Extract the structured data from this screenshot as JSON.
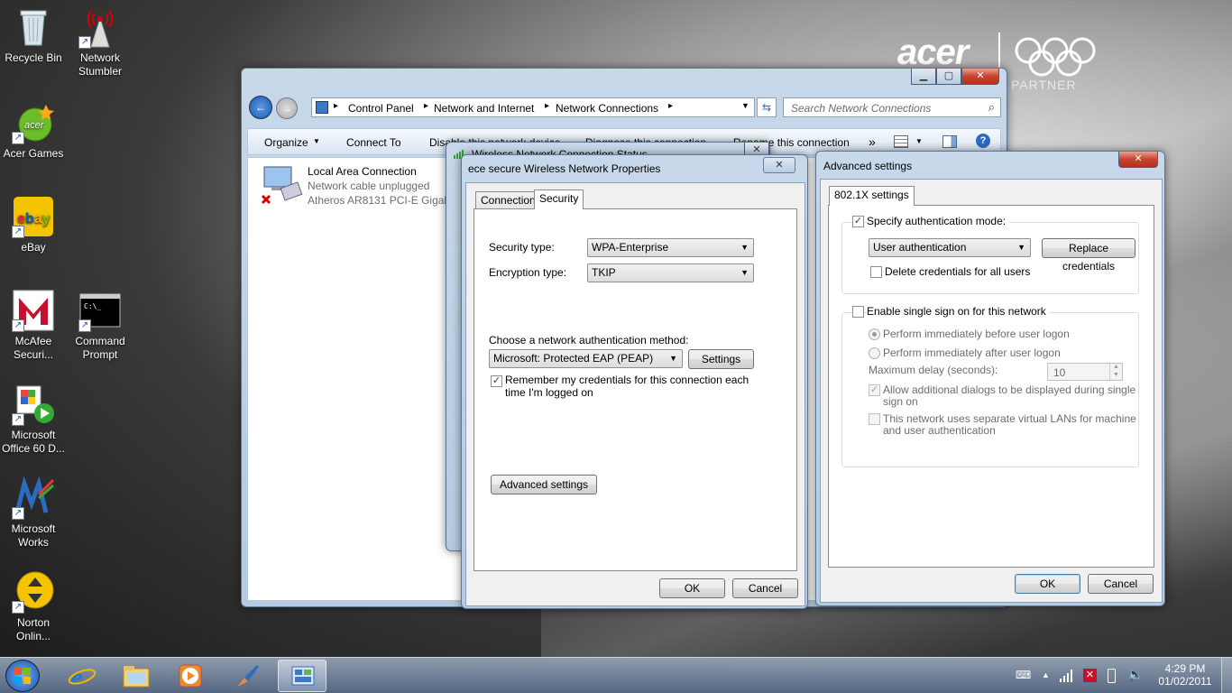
{
  "desktop": {
    "icons": [
      {
        "label": "Recycle Bin"
      },
      {
        "label": "Network Stumbler"
      },
      {
        "label": "Acer Games"
      },
      {
        "label": "eBay"
      },
      {
        "label": "McAfee Securi..."
      },
      {
        "label": "Command Prompt"
      },
      {
        "label": "Microsoft Office 60 D..."
      },
      {
        "label": "Microsoft Works"
      },
      {
        "label": "Norton Onlin..."
      }
    ],
    "brand": {
      "name": "acer",
      "tagline": "PARTNER"
    }
  },
  "explorer": {
    "breadcrumb": [
      "Control Panel",
      "Network and Internet",
      "Network Connections"
    ],
    "search_placeholder": "Search Network Connections",
    "toolbar": [
      "Organize",
      "Connect To",
      "Disable this network device",
      "Diagnose this connection",
      "Rename this connection"
    ],
    "more_label": "»",
    "connection": {
      "name": "Local Area Connection",
      "status": "Network cable unplugged",
      "adapter": "Atheros AR8131 PCI-E Gigab"
    }
  },
  "status_window": {
    "title": "Wireless Network Connection Status"
  },
  "properties": {
    "title": "ece secure Wireless Network Properties",
    "tabs": [
      "Connection",
      "Security"
    ],
    "security_type_label": "Security type:",
    "security_type_value": "WPA-Enterprise",
    "encryption_type_label": "Encryption type:",
    "encryption_type_value": "TKIP",
    "auth_method_label": "Choose a network authentication method:",
    "auth_method_value": "Microsoft: Protected EAP (PEAP)",
    "settings_button": "Settings",
    "remember_line1": "Remember my credentials for this connection each",
    "remember_line2": "time I'm logged on",
    "advanced_button": "Advanced settings",
    "ok": "OK",
    "cancel": "Cancel"
  },
  "advanced": {
    "title": "Advanced settings",
    "tab": "802.1X settings",
    "specify_auth": "Specify authentication mode:",
    "auth_mode": "User authentication",
    "replace_credentials": "Replace credentials",
    "delete_credentials": "Delete credentials for all users",
    "enable_sso": "Enable single sign on for this network",
    "before_logon": "Perform immediately before user logon",
    "after_logon": "Perform immediately after user logon",
    "max_delay_label": "Maximum delay (seconds):",
    "max_delay_value": "10",
    "allow_dialogs_line1": "Allow additional dialogs to be displayed during single",
    "allow_dialogs_line2": "sign on",
    "vlan_line1": "This network uses separate virtual LANs for machine",
    "vlan_line2": "and user authentication",
    "ok": "OK",
    "cancel": "Cancel"
  },
  "taskbar": {
    "time": "4:29 PM",
    "date": "01/02/2011"
  }
}
